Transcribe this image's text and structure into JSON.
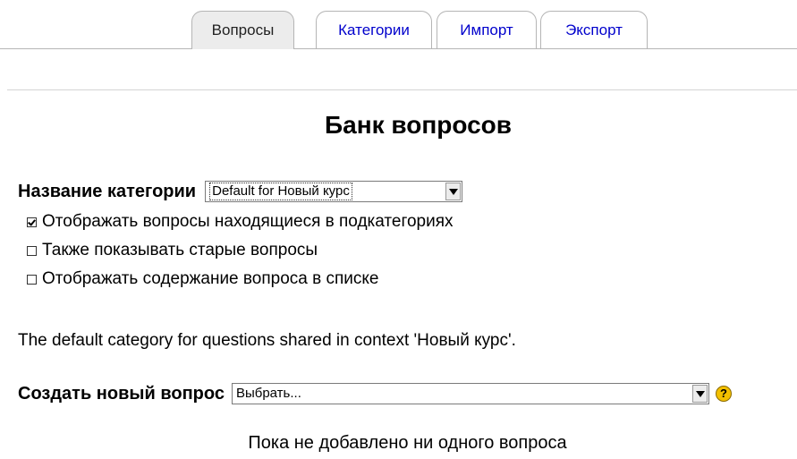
{
  "tabs": [
    {
      "label": "Вопросы",
      "active": true
    },
    {
      "label": "Категории",
      "active": false
    },
    {
      "label": "Импорт",
      "active": false
    },
    {
      "label": "Экспорт",
      "active": false
    }
  ],
  "page_title": "Банк вопросов",
  "category": {
    "label": "Название категории",
    "selected": "Default for Новый курс"
  },
  "options": [
    {
      "label": "Отображать вопросы находящиеся в подкатегориях",
      "checked": true
    },
    {
      "label": "Также показывать старые вопросы",
      "checked": false
    },
    {
      "label": "Отображать содержание вопроса в списке",
      "checked": false
    }
  ],
  "info_text": "The default category for questions shared in context 'Новый курс'.",
  "create_question": {
    "label": "Создать новый вопрос",
    "selected": "Выбрать...",
    "help_icon": "help-icon"
  },
  "empty_message": "Пока не добавлено ни одного вопроса",
  "colors": {
    "link": "#0000cc",
    "active_tab_bg": "#ececec",
    "help_icon": "#f3c000"
  }
}
